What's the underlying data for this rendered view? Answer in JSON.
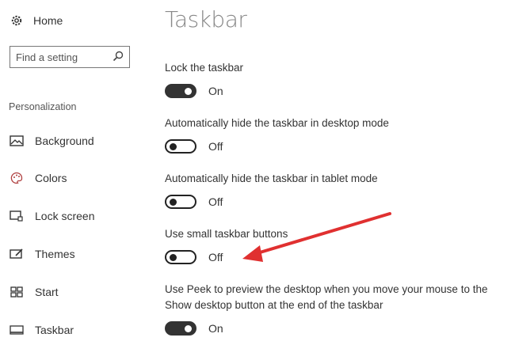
{
  "sidebar": {
    "home_label": "Home",
    "search_placeholder": "Find a setting",
    "section_label": "Personalization",
    "items": [
      {
        "label": "Background",
        "icon": "background-icon"
      },
      {
        "label": "Colors",
        "icon": "colors-icon"
      },
      {
        "label": "Lock screen",
        "icon": "lock-screen-icon"
      },
      {
        "label": "Themes",
        "icon": "themes-icon"
      },
      {
        "label": "Start",
        "icon": "start-icon"
      },
      {
        "label": "Taskbar",
        "icon": "taskbar-icon"
      }
    ]
  },
  "main": {
    "title": "Taskbar",
    "settings": [
      {
        "label": "Lock the taskbar",
        "state": "On",
        "on": true
      },
      {
        "label": "Automatically hide the taskbar in desktop mode",
        "state": "Off",
        "on": false
      },
      {
        "label": "Automatically hide the taskbar in tablet mode",
        "state": "Off",
        "on": false
      },
      {
        "label": "Use small taskbar buttons",
        "state": "Off",
        "on": false
      },
      {
        "label": "Use Peek to preview the desktop when you move your mouse to the Show desktop button at the end of the taskbar",
        "state": "On",
        "on": true
      }
    ]
  },
  "colors": {
    "arrow": "#e03030",
    "toggle_on": "#333333"
  }
}
